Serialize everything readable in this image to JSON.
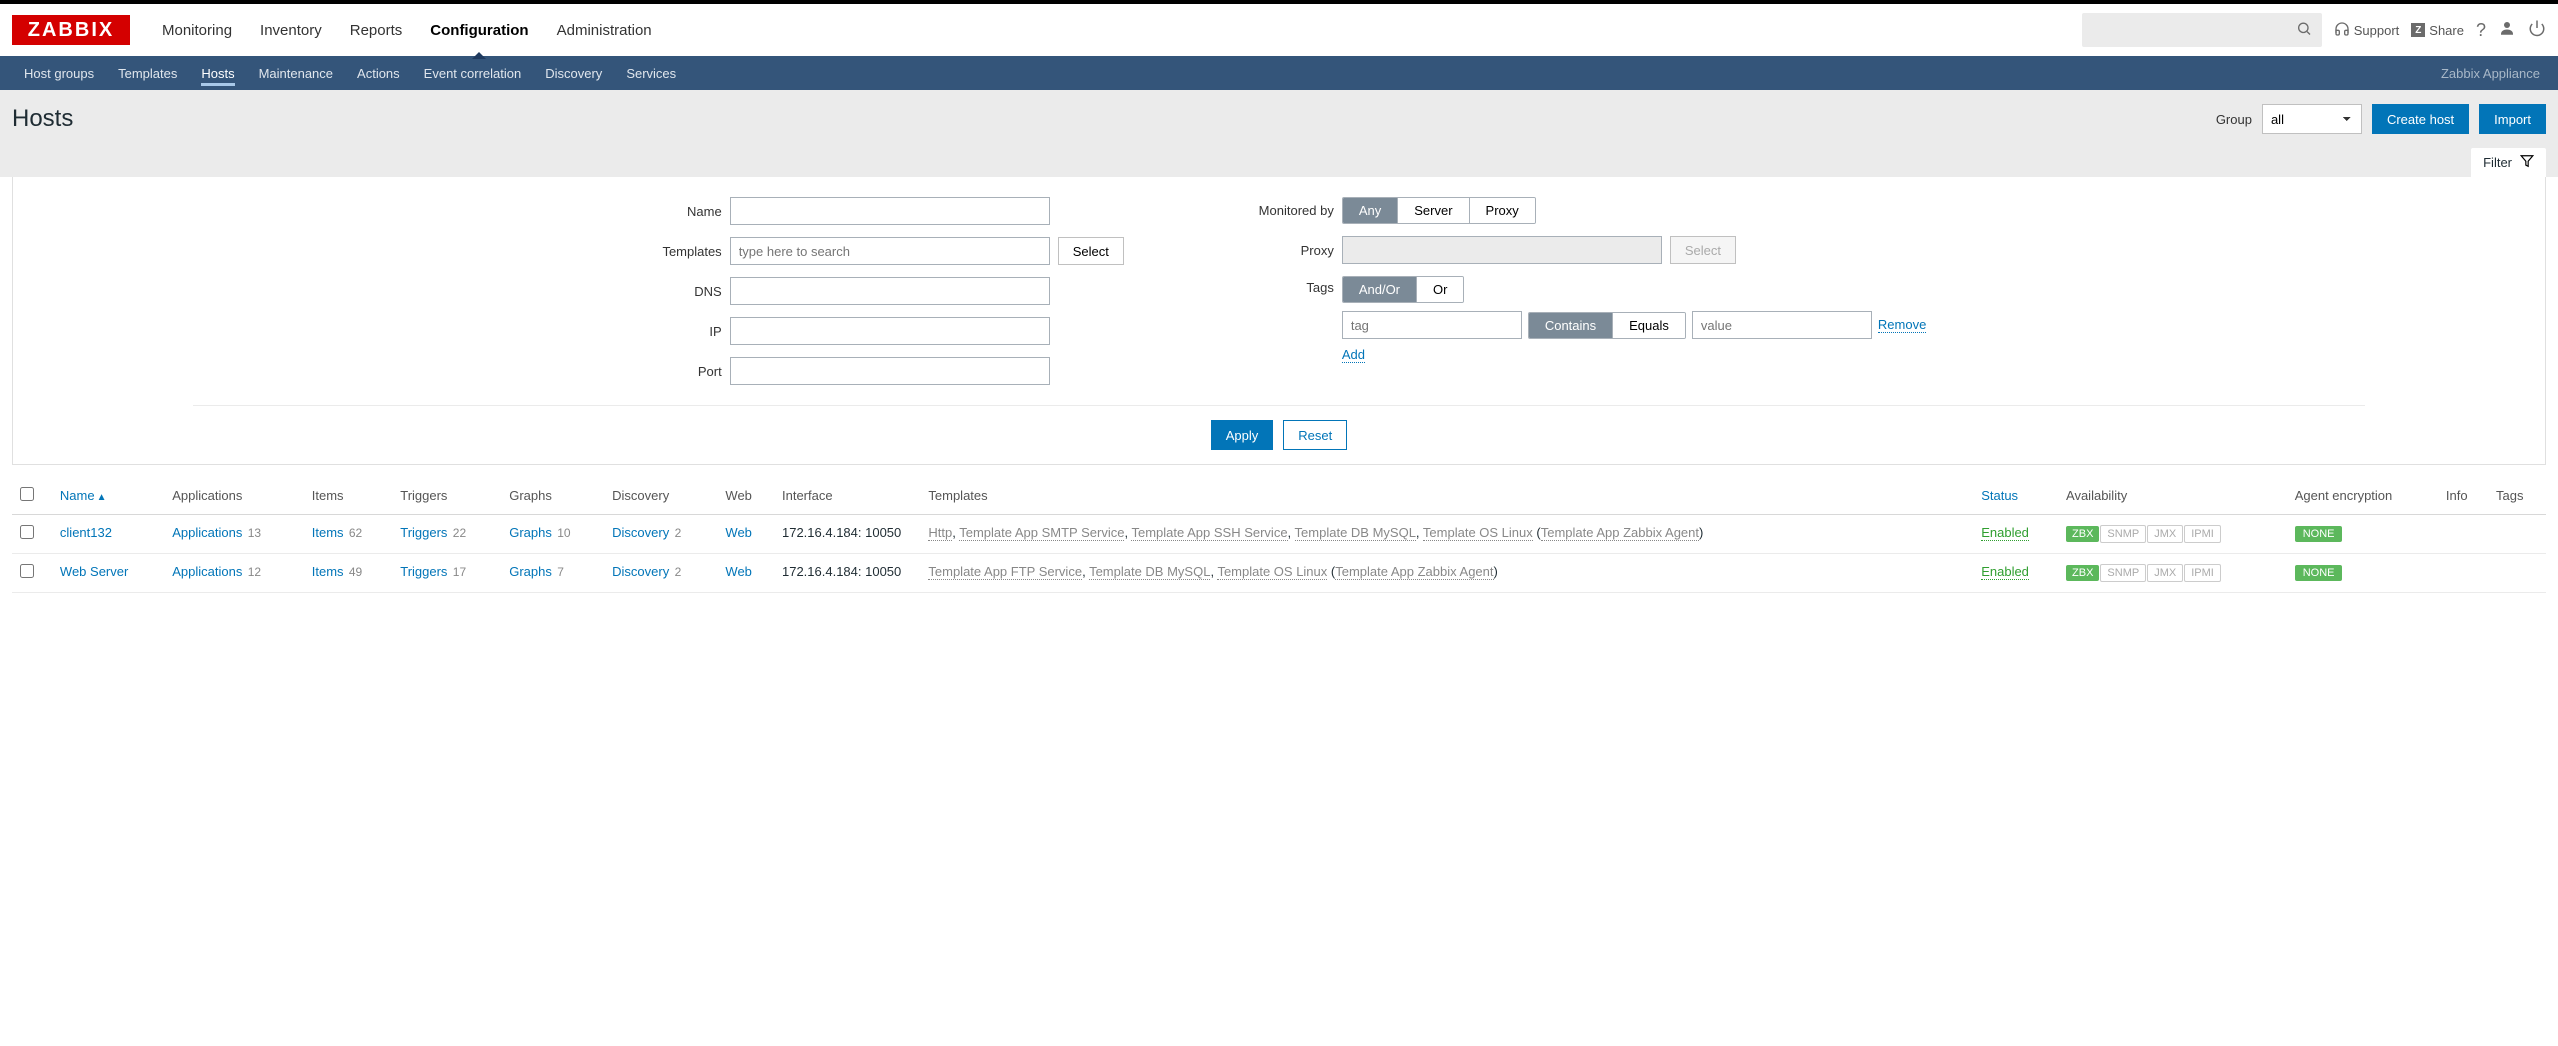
{
  "logo_text": "ZABBIX",
  "main_nav": [
    "Monitoring",
    "Inventory",
    "Reports",
    "Configuration",
    "Administration"
  ],
  "main_nav_active": "Configuration",
  "top_right": {
    "support": "Support",
    "share": "Share"
  },
  "sub_nav": [
    "Host groups",
    "Templates",
    "Hosts",
    "Maintenance",
    "Actions",
    "Event correlation",
    "Discovery",
    "Services"
  ],
  "sub_nav_active": "Hosts",
  "appliance_label": "Zabbix Appliance",
  "page_title": "Hosts",
  "group_label": "Group",
  "group_value": "all",
  "btn_create": "Create host",
  "btn_import": "Import",
  "filter_tab": "Filter",
  "filter": {
    "name_label": "Name",
    "templates_label": "Templates",
    "templates_placeholder": "type here to search",
    "select_btn": "Select",
    "dns_label": "DNS",
    "ip_label": "IP",
    "port_label": "Port",
    "monitored_label": "Monitored by",
    "monitored_opts": [
      "Any",
      "Server",
      "Proxy"
    ],
    "proxy_label": "Proxy",
    "tags_label": "Tags",
    "tags_mode": [
      "And/Or",
      "Or"
    ],
    "tag_placeholder": "tag",
    "tag_match": [
      "Contains",
      "Equals"
    ],
    "value_placeholder": "value",
    "remove": "Remove",
    "add": "Add",
    "apply": "Apply",
    "reset": "Reset"
  },
  "columns": [
    "",
    "Name",
    "Applications",
    "Items",
    "Triggers",
    "Graphs",
    "Discovery",
    "Web",
    "Interface",
    "Templates",
    "Status",
    "Availability",
    "Agent encryption",
    "Info",
    "Tags"
  ],
  "avail_badges": [
    "ZBX",
    "SNMP",
    "JMX",
    "IPMI"
  ],
  "rows": [
    {
      "name": "client132",
      "apps": {
        "label": "Applications",
        "count": "13"
      },
      "items": {
        "label": "Items",
        "count": "62"
      },
      "triggers": {
        "label": "Triggers",
        "count": "22"
      },
      "graphs": {
        "label": "Graphs",
        "count": "10"
      },
      "discovery": {
        "label": "Discovery",
        "count": "2"
      },
      "web": "Web",
      "interface": "172.16.4.184: 10050",
      "templates_parts": [
        "Http",
        ", ",
        "Template App SMTP Service",
        ", ",
        "Template App SSH Service",
        ", ",
        "Template DB MySQL",
        ", ",
        "Template OS Linux",
        " (",
        "Template App Zabbix Agent",
        ")"
      ],
      "status": "Enabled",
      "encryption": "NONE"
    },
    {
      "name": "Web Server",
      "apps": {
        "label": "Applications",
        "count": "12"
      },
      "items": {
        "label": "Items",
        "count": "49"
      },
      "triggers": {
        "label": "Triggers",
        "count": "17"
      },
      "graphs": {
        "label": "Graphs",
        "count": "7"
      },
      "discovery": {
        "label": "Discovery",
        "count": "2"
      },
      "web": "Web",
      "interface": "172.16.4.184: 10050",
      "templates_parts": [
        "Template App FTP Service",
        ", ",
        "Template DB MySQL",
        ", ",
        "Template OS Linux",
        " (",
        "Template App Zabbix Agent",
        ")"
      ],
      "status": "Enabled",
      "encryption": "NONE"
    }
  ]
}
